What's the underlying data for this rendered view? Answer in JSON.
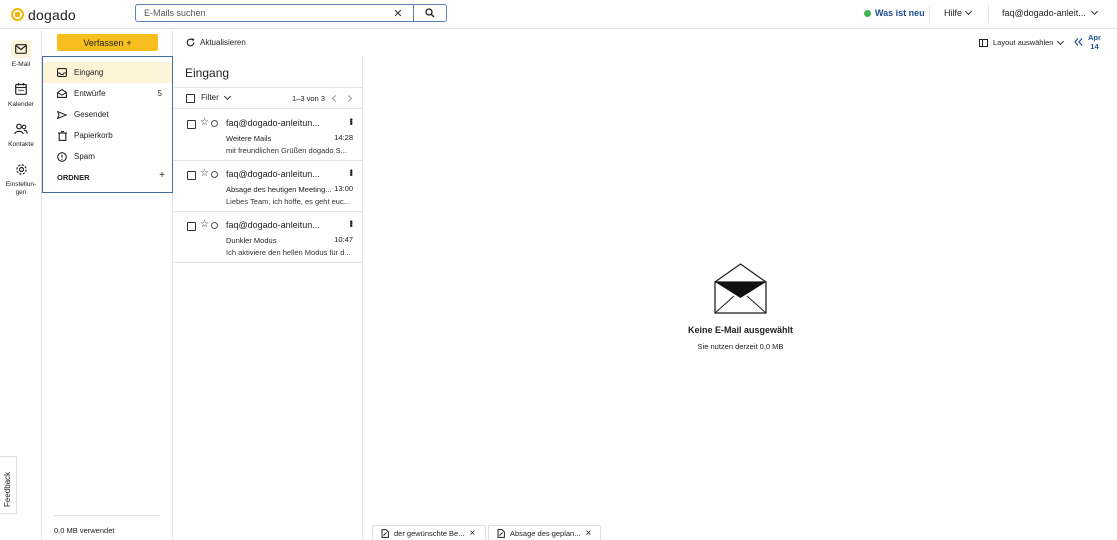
{
  "app": {
    "brand": "dogado"
  },
  "search": {
    "placeholder": "E-Mails suchen",
    "clear_glyph": "✕"
  },
  "header": {
    "whats_new": "Was ist neu",
    "help": "Hilfe",
    "user": "faq@dogado-anleit..."
  },
  "rail": {
    "items": [
      {
        "label": "E-Mail",
        "icon": "mail-icon",
        "active": true
      },
      {
        "label": "Kalender",
        "icon": "calendar-icon"
      },
      {
        "label": "Kontakte",
        "icon": "contacts-icon"
      },
      {
        "label": "Einstellun-\ngen",
        "icon": "gear-icon"
      }
    ],
    "feedback": "Feedback"
  },
  "compose": {
    "label": "Verfassen",
    "plus": "+"
  },
  "folders": {
    "items": [
      {
        "label": "Eingang",
        "icon": "inbox-icon",
        "active": true,
        "count": ""
      },
      {
        "label": "Entwürfe",
        "icon": "drafts-icon",
        "count": "5"
      },
      {
        "label": "Gesendet",
        "icon": "send-icon",
        "count": ""
      },
      {
        "label": "Papierkorb",
        "icon": "trash-icon",
        "count": ""
      },
      {
        "label": "Spam",
        "icon": "spam-icon",
        "count": ""
      }
    ],
    "section": "ORDNER",
    "add": "+"
  },
  "storage": {
    "usage": "0,0 MB verwendet"
  },
  "toolbar": {
    "refresh": "Aktualisieren",
    "layout": "Layout auswählen",
    "date_month": "Apr",
    "date_day": "14"
  },
  "list": {
    "title": "Eingang",
    "filter": "Filter",
    "pager": "1–3 von 3",
    "mails": [
      {
        "from": "faq@dogado-anleitun...",
        "subject": "Weitere Mails",
        "time": "14:28",
        "preview": "mit freundlichen Grüßen dogado S..."
      },
      {
        "from": "faq@dogado-anleitun...",
        "subject": "Absage des heutigen Meeting...",
        "time": "13:00",
        "preview": "Liebes Team, ich hoffe, es geht euc..."
      },
      {
        "from": "faq@dogado-anleitun...",
        "subject": "Dunkler Modus",
        "time": "10:47",
        "preview": "Ich aktiviere den hellen Modus für d..."
      }
    ]
  },
  "reader": {
    "empty_title": "Keine E-Mail ausgewählt",
    "empty_sub": "Sie nutzen derzeit 0,0 MB"
  },
  "drafts_tabs": [
    {
      "label": "der gewünschte Be..."
    },
    {
      "label": "Absage des geplan..."
    }
  ],
  "colors": {
    "accent": "#f7be1d",
    "link": "#1f4e8f",
    "active_bg": "#fdf3d6",
    "online": "#3fb34f"
  }
}
